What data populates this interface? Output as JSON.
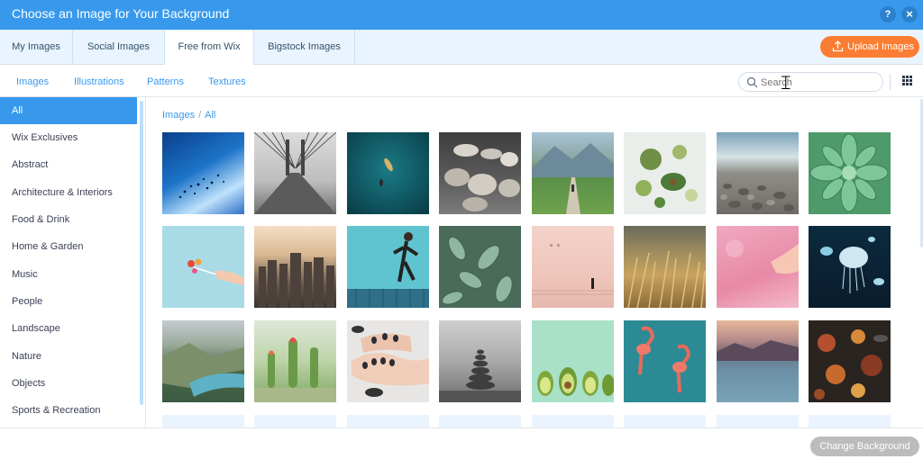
{
  "window": {
    "title": "Choose an Image for Your Background",
    "help_label": "?",
    "close_label": "×"
  },
  "tabs": [
    {
      "label": "My Images"
    },
    {
      "label": "Social Images"
    },
    {
      "label": "Free from Wix",
      "active": true
    },
    {
      "label": "Bigstock Images"
    }
  ],
  "upload_button": {
    "label": "Upload Images",
    "icon": "upload-icon"
  },
  "subtabs": [
    {
      "label": "Images"
    },
    {
      "label": "Illustrations"
    },
    {
      "label": "Patterns"
    },
    {
      "label": "Textures"
    }
  ],
  "search": {
    "placeholder": "Search",
    "value": ""
  },
  "view_toggle": {
    "icon": "grid-view-icon"
  },
  "sidebar": {
    "items": [
      {
        "label": "All",
        "active": true
      },
      {
        "label": "Wix Exclusives"
      },
      {
        "label": "Abstract"
      },
      {
        "label": "Architecture & Interiors"
      },
      {
        "label": "Food & Drink"
      },
      {
        "label": "Home & Garden"
      },
      {
        "label": "Music"
      },
      {
        "label": "People"
      },
      {
        "label": "Landscape"
      },
      {
        "label": "Nature"
      },
      {
        "label": "Objects"
      },
      {
        "label": "Sports & Recreation"
      }
    ]
  },
  "breadcrumb": {
    "root": "Images",
    "separator": "/",
    "current": "All"
  },
  "images": [
    {
      "subject": "birds flying in blue sky"
    },
    {
      "subject": "suspension bridge cables"
    },
    {
      "subject": "aerial kayak on teal water"
    },
    {
      "subject": "stacked ceramic bowls"
    },
    {
      "subject": "person walking on mountain path"
    },
    {
      "subject": "green vegetables and avocado"
    },
    {
      "subject": "pebble beach and waves"
    },
    {
      "subject": "green succulent"
    },
    {
      "subject": "hand holding lollipop"
    },
    {
      "subject": "city skyline"
    },
    {
      "subject": "woman running"
    },
    {
      "subject": "succulents close up"
    },
    {
      "subject": "pink wall with figure"
    },
    {
      "subject": "golden wheat field"
    },
    {
      "subject": "hand in pink water"
    },
    {
      "subject": "jellyfish"
    },
    {
      "subject": "fjord landscape"
    },
    {
      "subject": "cactus plants"
    },
    {
      "subject": "manicured hands with stones"
    },
    {
      "subject": "stacked stones on beach"
    },
    {
      "subject": "avocado halves on mint"
    },
    {
      "subject": "flamingos on teal"
    },
    {
      "subject": "mountain lake at dusk"
    },
    {
      "subject": "spices on dark table"
    }
  ],
  "footer": {
    "change_button": "Change Background"
  },
  "colors": {
    "accent": "#3899ec",
    "titlebar": "#3899ec",
    "upload": "#fb7d33",
    "disabled": "#bcbcbc",
    "tab_background": "#eaf4fe"
  }
}
